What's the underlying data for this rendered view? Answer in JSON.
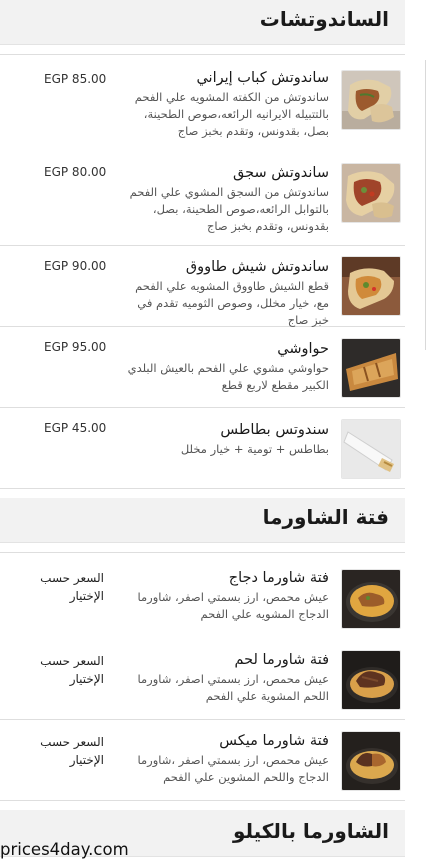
{
  "sections": [
    {
      "title": "الساندوتشات",
      "items": [
        {
          "name": "ساندوتش كباب إيراني",
          "desc": "ساندوتش من الكفته المشويه علي الفحم بالتتبيله الايرانيه الرائعه،صوص الطحينة، بصل، بقدونس، وتقدم بخبز صاج",
          "price": "EGP 85.00"
        },
        {
          "name": "ساندوتش سجق",
          "desc": "ساندوتش من السجق المشوي علي الفحم بالتوابل الرائعه،صوص الطحينة، بصل، بقدونس، وتقدم بخبز صاج",
          "price": "EGP 80.00"
        },
        {
          "name": "ساندوتش شيش طاووق",
          "desc": "قطع الشيش طاووق المشويه علي الفحم مع، خيار مخلل، وصوص الثوميه تقدم في خبز صاج",
          "price": "EGP 90.00"
        },
        {
          "name": "حواوشي",
          "desc": "حواوشي مشوي علي الفحم بالعيش البلدي الكبير مقطع لاربع قطع",
          "price": "EGP 95.00"
        },
        {
          "name": "سندوتس بطاطس",
          "desc": "بطاطس + تومية + خيار مخلل",
          "price": "EGP 45.00"
        }
      ]
    },
    {
      "title": "فتة الشاورما",
      "items": [
        {
          "name": "فتة شاورما دجاج",
          "desc": "عيش محمص، ارز بسمتي اصفر، شاورما الدجاج المشويه علي الفحم",
          "price": "السعر حسب الإختيار"
        },
        {
          "name": "فتة شاورما لحم",
          "desc": "عيش محمص، ارز بسمتي اصفر، شاورما اللحم المشوية علي الفحم",
          "price": "السعر حسب الإختيار"
        },
        {
          "name": "فتة شاورما ميكس",
          "desc": "عيش محمص، ارز بسمتي اصفر ،شاورما الدجاج واللحم المشوين علي الفحم",
          "price": "السعر حسب الإختيار"
        }
      ]
    },
    {
      "title": "الشاورما بالكيلو",
      "items": []
    }
  ],
  "watermark": "prices4day.com",
  "colors": {
    "header_bg": "#f2f2f2",
    "divider": "#dedede",
    "text": "#1a1a1a",
    "desc": "#555555"
  }
}
